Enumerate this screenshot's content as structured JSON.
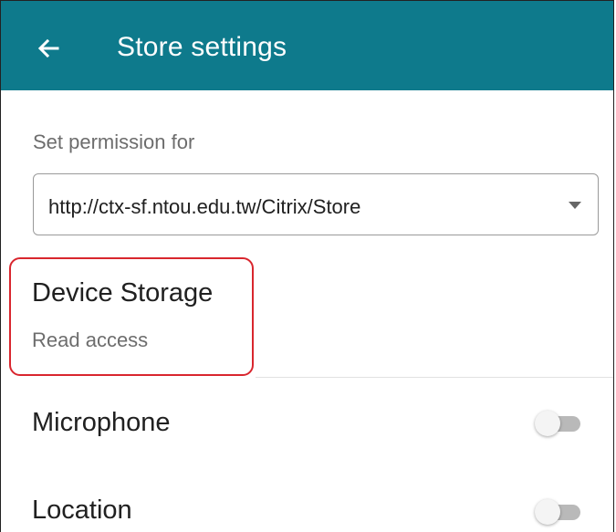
{
  "header": {
    "title": "Store settings",
    "back_icon": "arrow-left-icon",
    "background_color": "#0e7a8c"
  },
  "permission_selector": {
    "label": "Set permission for",
    "selected_value": "http://ctx-sf.ntou.edu.tw/Citrix/Store"
  },
  "device_storage": {
    "title": "Device Storage",
    "subtitle": "Read access",
    "highlight_color": "#d9262e"
  },
  "permissions": [
    {
      "label": "Microphone",
      "enabled": false
    },
    {
      "label": "Location",
      "enabled": false
    }
  ]
}
